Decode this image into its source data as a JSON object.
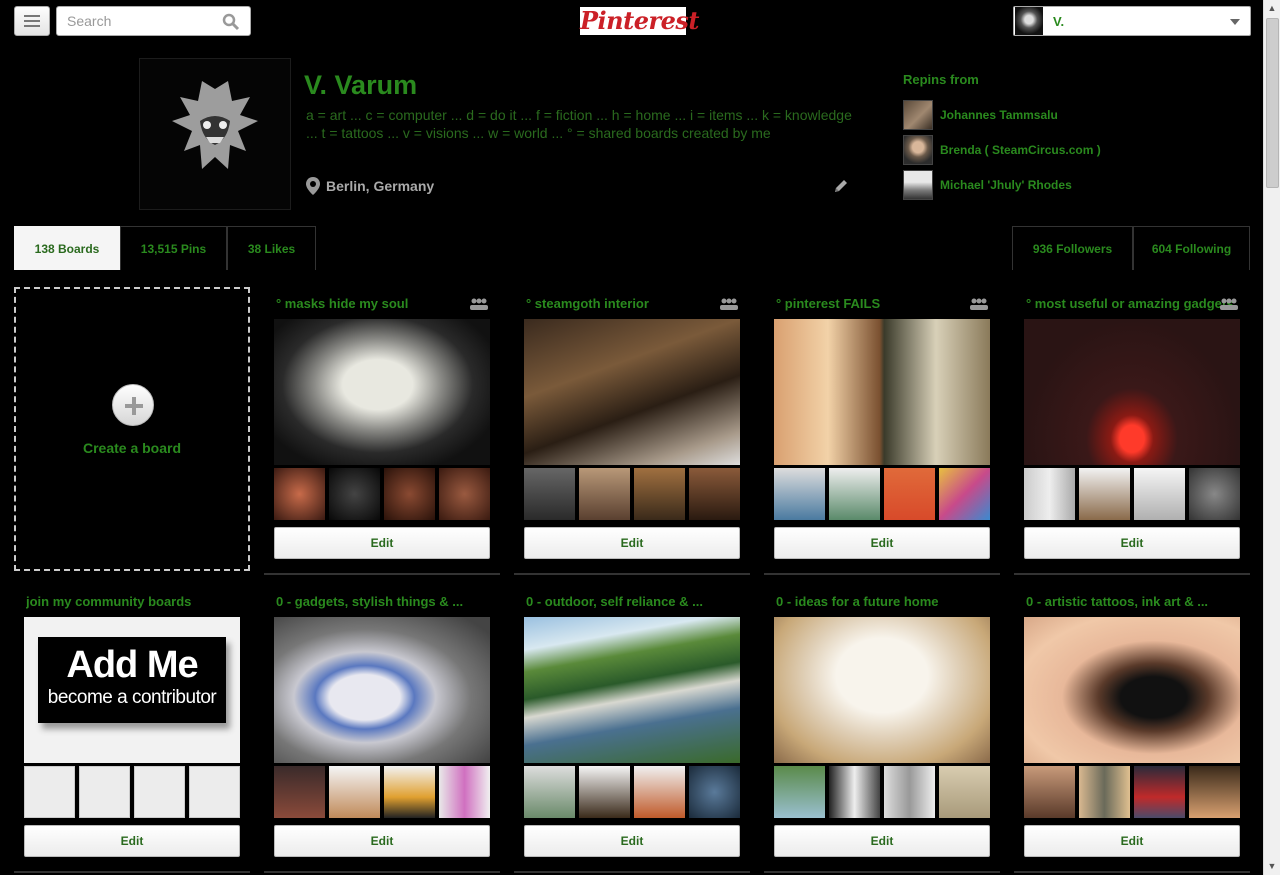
{
  "header": {
    "search_placeholder": "Search",
    "logo_text": "Pinterest",
    "user_name": "V."
  },
  "profile": {
    "name": "V. Varum",
    "about": "a = art ... c = computer ... d = do it ... f = fiction ... h = home ... i = items ... k = knowledge ... t = tattoos ... v = visions ... w = world ... ° = shared boards created by me",
    "location": "Berlin, Germany"
  },
  "repins": {
    "title": "Repins from",
    "items": [
      {
        "name": "Johannes Tammsalu"
      },
      {
        "name": "Brenda ( SteamCircus.com )"
      },
      {
        "name": "Michael 'Jhuly' Rhodes"
      }
    ]
  },
  "tabs": {
    "boards": "138 Boards",
    "pins": "13,515 Pins",
    "likes": "38 Likes",
    "followers": "936 Followers",
    "following": "604 Following"
  },
  "create_board": {
    "label": "Create a board"
  },
  "boards": [
    {
      "title": "° masks hide my soul",
      "edit": "Edit",
      "group": true
    },
    {
      "title": "° steamgoth interior",
      "edit": "Edit",
      "group": true
    },
    {
      "title": "° pinterest FAILS",
      "edit": "Edit",
      "group": true
    },
    {
      "title": "° most useful or amazing gadgets",
      "edit": "Edit",
      "group": true
    },
    {
      "title": "join my community boards",
      "edit": "Edit",
      "group": false,
      "card_big": "Add Me",
      "card_small": "become a contributor"
    },
    {
      "title": "0 - gadgets, stylish things & ...",
      "edit": "Edit",
      "group": false
    },
    {
      "title": "0 - outdoor, self reliance & ...",
      "edit": "Edit",
      "group": false
    },
    {
      "title": "0 - ideas for a future home",
      "edit": "Edit",
      "group": false
    },
    {
      "title": "0 - artistic tattoos, ink art & ...",
      "edit": "Edit",
      "group": false
    }
  ],
  "colors": {
    "accent_green": "#2a8a1e",
    "background": "#000000",
    "logo_red": "#cb2027"
  }
}
